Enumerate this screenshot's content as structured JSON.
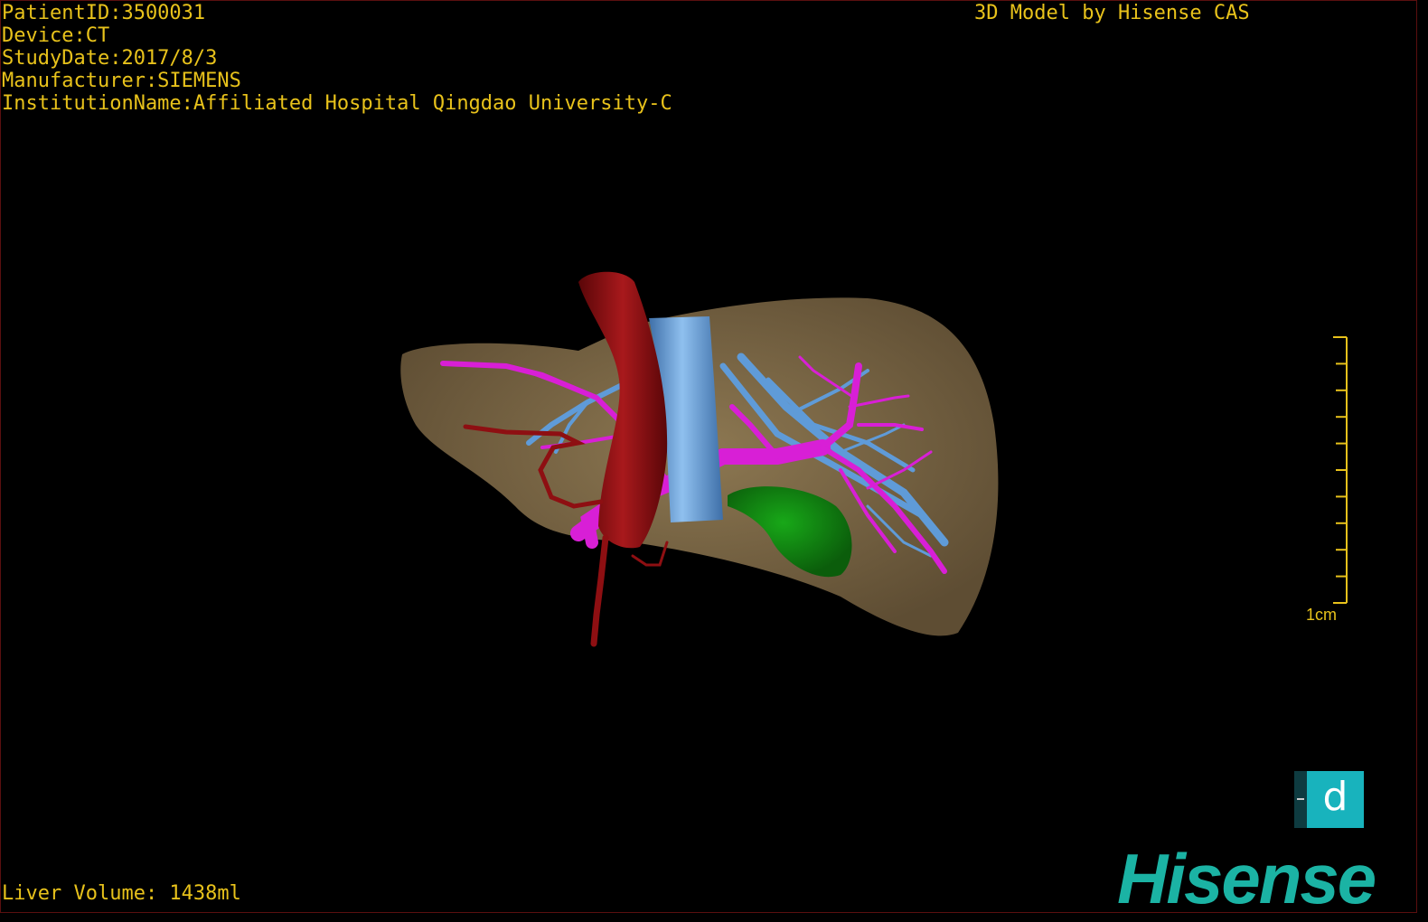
{
  "overlay": {
    "patient_id": "PatientID:3500031",
    "device": "Device:CT",
    "study_date": "StudyDate:2017/8/3",
    "manufacturer": "Manufacturer:SIEMENS",
    "institution": "InstitutionName:Affiliated Hospital Qingdao University-C",
    "credit": "3D Model by Hisense CAS",
    "liver_volume": "Liver Volume: 1438ml"
  },
  "scale_bar": {
    "label": "1cm"
  },
  "nav_cube": {
    "face_label": "d"
  },
  "brand": {
    "logo_text": "Hisense"
  },
  "colors": {
    "overlay_text": "#e8c21b",
    "liver": "#7e6a4a",
    "artery": "#8e0f12",
    "portal_vein": "#d81fd6",
    "hepatic_vein": "#5f9bd8",
    "gallbladder": "#138a12",
    "brand": "#1bb3a4"
  }
}
